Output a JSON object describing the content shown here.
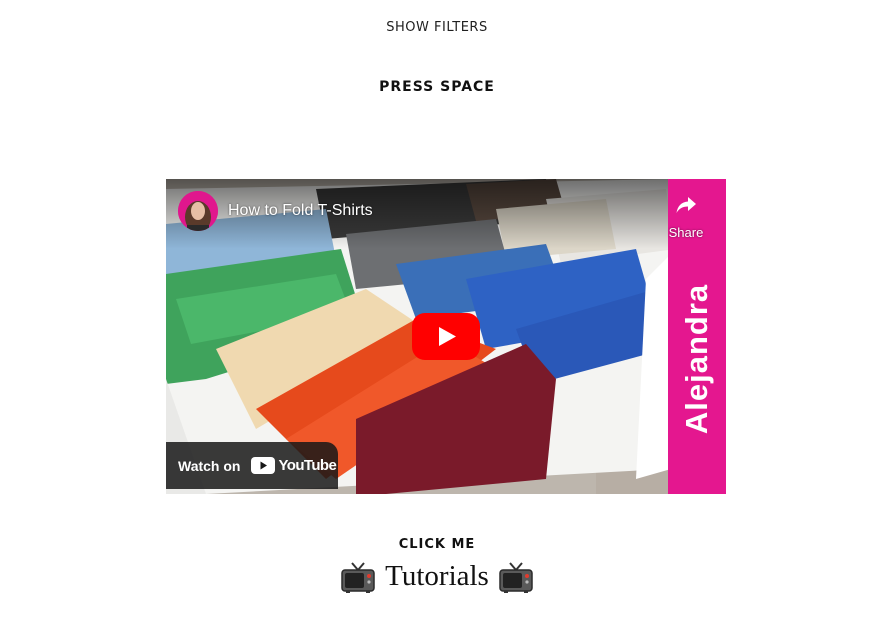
{
  "header": {
    "show_filters": "SHOW FILTERS",
    "press_space": "PRESS SPACE"
  },
  "video": {
    "title": "How to Fold T-Shirts",
    "share_label": "Share",
    "watch_on_label": "Watch on",
    "youtube_wordmark": "YouTube",
    "brand_text": "Alejandra",
    "accent_color": "#e4178f",
    "play_button_color": "#ff0000"
  },
  "footer": {
    "click_me": "CLICK ME",
    "tutorials_label": "Tutorials",
    "icon": "television-icon"
  }
}
